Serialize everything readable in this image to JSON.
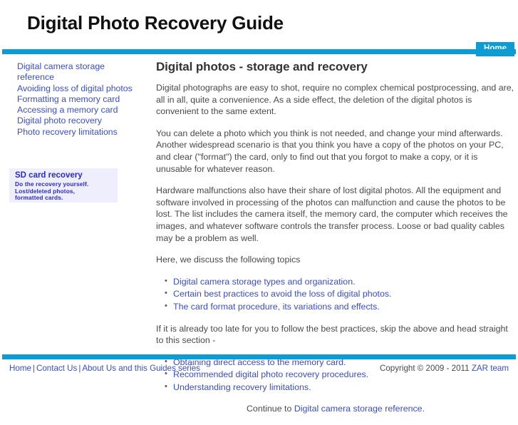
{
  "header": {
    "site_title": "Digital Photo Recovery Guide",
    "nav_home_label": "Home",
    "accent_color": "#0d9bd4",
    "link_color": "#3b4ec6"
  },
  "sidebar": {
    "links": [
      {
        "label": "Digital camera storage reference"
      },
      {
        "label": "Avoiding loss of digital photos"
      },
      {
        "label": "Formatting a memory card"
      },
      {
        "label": "Accessing a memory card"
      },
      {
        "label": "Digital photo recovery"
      },
      {
        "label": "Photo recovery limitations"
      }
    ],
    "ad": {
      "title": "SD card recovery",
      "line1": "Do the recovery yourself.",
      "line2": "Lost/deleted photos,",
      "line3": "formatted cards.",
      "background_color": "#eeeefc",
      "text_color": "#2b2bcc"
    }
  },
  "main": {
    "heading": "Digital photos - storage and recovery",
    "paragraph1": "Digital photographs are easy to shot, require no complex chemical postprocessing, and are, all in all, quite a convenience. As a side effect, the deletion of the digital photos is convenient to the same extent.",
    "paragraph2": "You can delete a photo which you think is not needed, and change your mind afterwards. Another widespread scenario is that you think you have a copy of the photos on your PC, and clear (\"format\") the card, only to find out that you forgot to make a copy, or it is unusable for whatever reason.",
    "paragraph3": "Hardware malfunctions also have their share of lost digital photos. All the equipment and software involved in processing of the photos can malfunction and cause the photos to be lost. The list includes the camera itself, the memory card, the computer which receives the images, and whatever software controls the transfer process. Loose or bad quality cables may be a problem as well.",
    "topics_intro": "Here, we discuss the following topics",
    "topics": [
      {
        "label": "Digital camera storage types and organization."
      },
      {
        "label": "Certain best practices to avoid the loss of digital photos."
      },
      {
        "label": "The card format procedure, its variations and effects."
      }
    ],
    "skip_intro": "If it is already too late for you to follow the best practices, skip the above and head straight to this section -",
    "recovery_topics": [
      {
        "label": "Obtaining direct access to the memory card."
      },
      {
        "label": "Recommended digital photo recovery procedures."
      },
      {
        "label": "Understanding recovery limitations."
      }
    ],
    "continue_prefix": "Continue to ",
    "continue_link": "Digital camera storage reference",
    "continue_suffix": "."
  },
  "footer": {
    "links": [
      {
        "label": "Home"
      },
      {
        "label": "Contact Us"
      },
      {
        "label": "About Us and this Guides series"
      }
    ],
    "separator": "|",
    "copyright_text": "Copyright © 2009 - 2011 ",
    "copyright_link": "ZAR team"
  }
}
